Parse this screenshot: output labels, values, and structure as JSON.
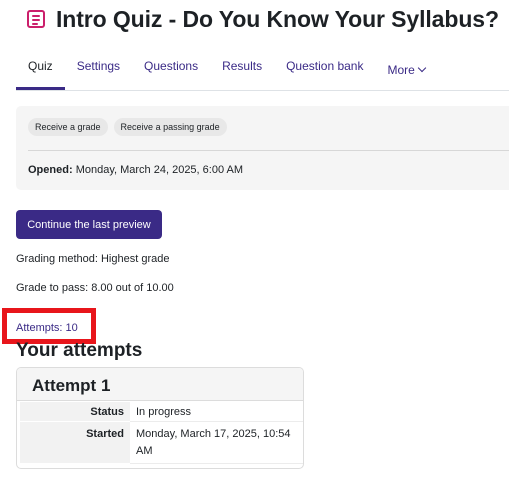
{
  "header": {
    "title": "Intro Quiz - Do You Know Your Syllabus?",
    "icon": "quiz-icon",
    "icon_color": "#cb1f6b"
  },
  "tabs": [
    {
      "label": "Quiz",
      "active": true
    },
    {
      "label": "Settings"
    },
    {
      "label": "Questions"
    },
    {
      "label": "Results"
    },
    {
      "label": "Question bank"
    },
    {
      "label": "More"
    }
  ],
  "activity": {
    "badges": [
      "Receive a grade",
      "Receive a passing grade"
    ],
    "opened_label": "Opened:",
    "opened_value": "Monday, March 24, 2025, 6:00 AM"
  },
  "actions": {
    "continue_preview": "Continue the last preview"
  },
  "summary": {
    "grading_method": "Grading method: Highest grade",
    "grade_to_pass": "Grade to pass: 8.00 out of 10.00",
    "attempts": "Attempts: 10"
  },
  "attempts_section": {
    "heading": "Your attempts",
    "attempt": {
      "title": "Attempt 1",
      "rows": [
        {
          "label": "Status",
          "value": "In progress"
        },
        {
          "label": "Started",
          "value": "Monday, March 17, 2025, 10:54 AM"
        }
      ]
    }
  },
  "colors": {
    "brand": "#3a2a86",
    "highlight": "#e8151b"
  }
}
